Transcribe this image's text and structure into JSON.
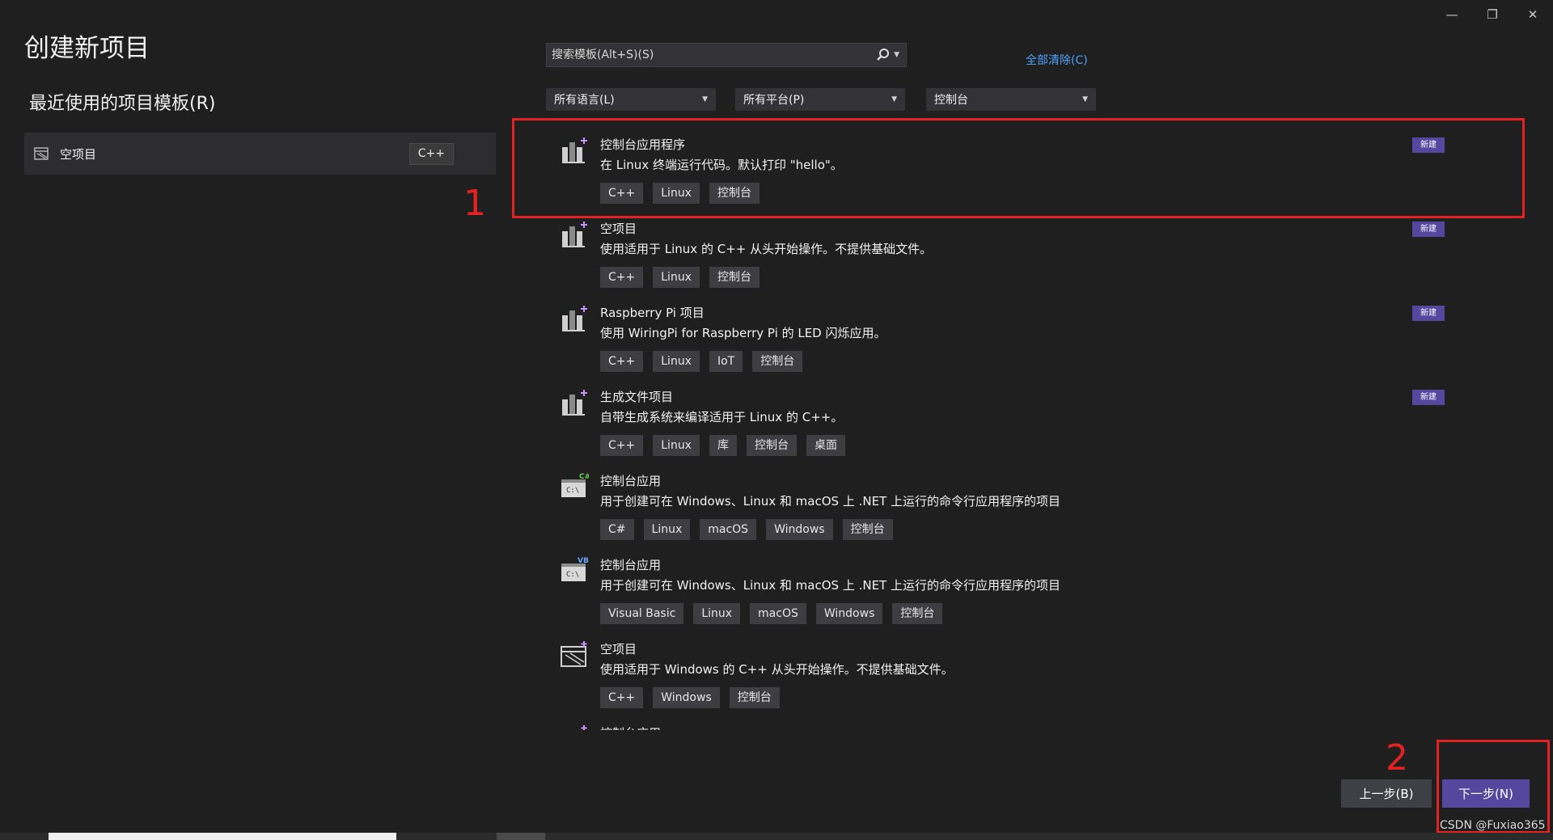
{
  "window": {
    "minimize_icon": "minimize-icon",
    "restore_icon": "restore-icon",
    "close_icon": "close-icon"
  },
  "header": {
    "title": "创建新项目",
    "recent_title": "最近使用的项目模板(R)"
  },
  "recent": [
    {
      "label": "空项目",
      "lang": "C++",
      "icon": "empty-project-icon"
    }
  ],
  "search": {
    "placeholder": "搜索模板(Alt+S)(S)",
    "clear_all": "全部清除(C)"
  },
  "filters": [
    {
      "label": "所有语言(L)"
    },
    {
      "label": "所有平台(P)"
    },
    {
      "label": "控制台"
    }
  ],
  "templates": [
    {
      "name": "控制台应用程序",
      "desc": "在 Linux 终端运行代码。默认打印 \"hello\"。",
      "tags": [
        "C++",
        "Linux",
        "控制台"
      ],
      "badge": "新建",
      "icon": "linux-project-icon"
    },
    {
      "name": "空项目",
      "desc": "使用适用于 Linux 的 C++ 从头开始操作。不提供基础文件。",
      "tags": [
        "C++",
        "Linux",
        "控制台"
      ],
      "badge": "新建",
      "icon": "linux-project-icon"
    },
    {
      "name": "Raspberry Pi 项目",
      "desc": "使用 WiringPi for Raspberry Pi 的 LED 闪烁应用。",
      "tags": [
        "C++",
        "Linux",
        "IoT",
        "控制台"
      ],
      "badge": "新建",
      "icon": "linux-project-icon"
    },
    {
      "name": "生成文件项目",
      "desc": "自带生成系统来编译适用于 Linux 的 C++。",
      "tags": [
        "C++",
        "Linux",
        "库",
        "控制台",
        "桌面"
      ],
      "badge": "新建",
      "icon": "linux-project-icon"
    },
    {
      "name": "控制台应用",
      "desc": "用于创建可在 Windows、Linux 和 macOS 上 .NET 上运行的命令行应用程序的项目",
      "tags": [
        "C#",
        "Linux",
        "macOS",
        "Windows",
        "控制台"
      ],
      "badge": "",
      "icon": "csharp-console-icon"
    },
    {
      "name": "控制台应用",
      "desc": "用于创建可在 Windows、Linux 和 macOS 上 .NET 上运行的命令行应用程序的项目",
      "tags": [
        "Visual Basic",
        "Linux",
        "macOS",
        "Windows",
        "控制台"
      ],
      "badge": "",
      "icon": "vb-console-icon"
    },
    {
      "name": "空项目",
      "desc": "使用适用于 Windows 的 C++ 从头开始操作。不提供基础文件。",
      "tags": [
        "C++",
        "Windows",
        "控制台"
      ],
      "badge": "",
      "icon": "empty-project-icon"
    },
    {
      "name": "控制台应用",
      "desc": "",
      "tags": [],
      "badge": "",
      "icon": "cpp-console-icon"
    }
  ],
  "annotations": {
    "one": "1",
    "two": "2"
  },
  "footer": {
    "back_label": "上一步(B)",
    "next_label": "下一步(N)",
    "watermark": "CSDN @Fuxiao365"
  },
  "colors": {
    "accent": "#56479e",
    "annotation": "#e52222",
    "link": "#4fa3ff"
  }
}
